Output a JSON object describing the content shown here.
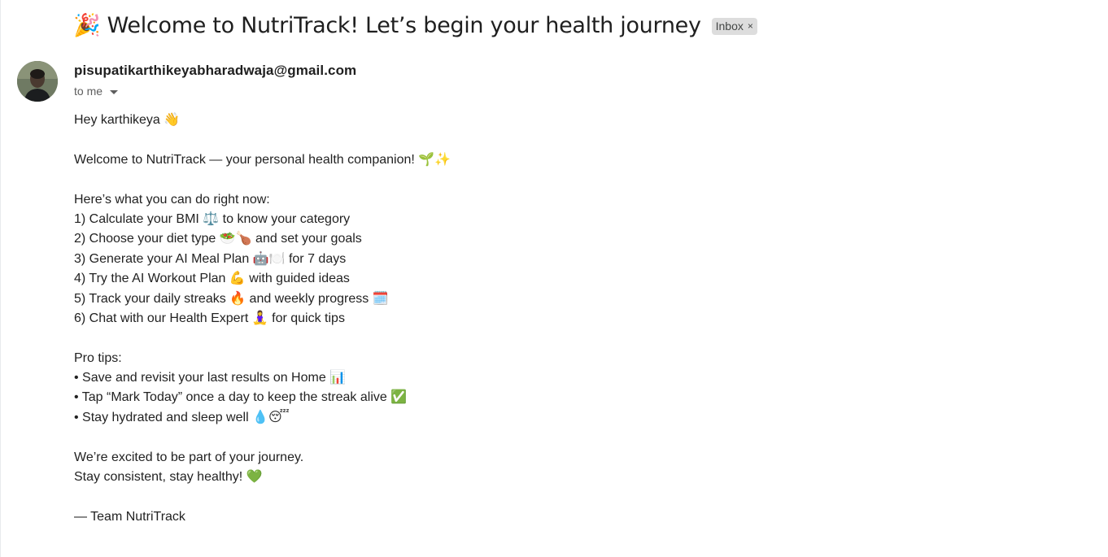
{
  "subject": "🎉 Welcome to NutriTrack! Let’s begin your health journey",
  "label_chip": {
    "text": "Inbox",
    "remove": "×"
  },
  "sender": {
    "email": "pisupatikarthikeyabharadwaja@gmail.com",
    "to": "to me"
  },
  "body": {
    "greeting": "Hey karthikeya 👋",
    "intro": "Welcome to NutriTrack — your personal health companion! 🌱✨",
    "list_heading": "Here’s what you can do right now:",
    "items": [
      "1) Calculate your BMI ⚖️ to know your category",
      "2) Choose your diet type 🥗🍗 and set your goals",
      "3) Generate your AI Meal Plan 🤖🍽️ for 7 days",
      "4) Try the AI Workout Plan 💪 with guided ideas",
      "5) Track your daily streaks 🔥 and weekly progress 🗓️",
      "6) Chat with our Health Expert 🧘‍♀️ for quick tips"
    ],
    "tips_heading": "Pro tips:",
    "tips": [
      "• Save and revisit your last results on Home 📊",
      "• Tap “Mark Today” once a day to keep the streak alive ✅",
      "• Stay hydrated and sleep well 💧😴"
    ],
    "closing_1": "We’re excited to be part of your journey.",
    "closing_2": "Stay consistent, stay healthy! 💚",
    "signature": "— Team NutriTrack"
  }
}
